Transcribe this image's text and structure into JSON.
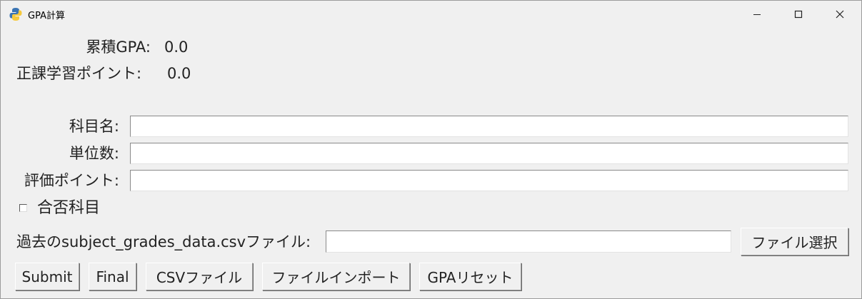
{
  "window": {
    "title": "GPA計算",
    "icon": "python-icon",
    "controls": [
      "minimize-icon",
      "maximize-icon",
      "close-icon"
    ]
  },
  "summary": {
    "cumulative_gpa_label": "累積GPA:",
    "cumulative_gpa_value": "0.0",
    "points_label": "正課学習ポイント:",
    "points_value": "0.0"
  },
  "form": {
    "subject_label": "科目名:",
    "subject_value": "",
    "credits_label": "単位数:",
    "credits_value": "",
    "grade_label": "評価ポイント:",
    "grade_value": "",
    "pass_fail_label": "合否科目",
    "pass_fail_checked": false
  },
  "file_import": {
    "label": "過去のsubject_grades_data.csvファイル:",
    "path_value": "",
    "browse_label": "ファイル選択"
  },
  "actions": {
    "submit": "Submit",
    "final": "Final",
    "csv": "CSVファイル",
    "import": "ファイルインポート",
    "reset": "GPAリセット"
  }
}
